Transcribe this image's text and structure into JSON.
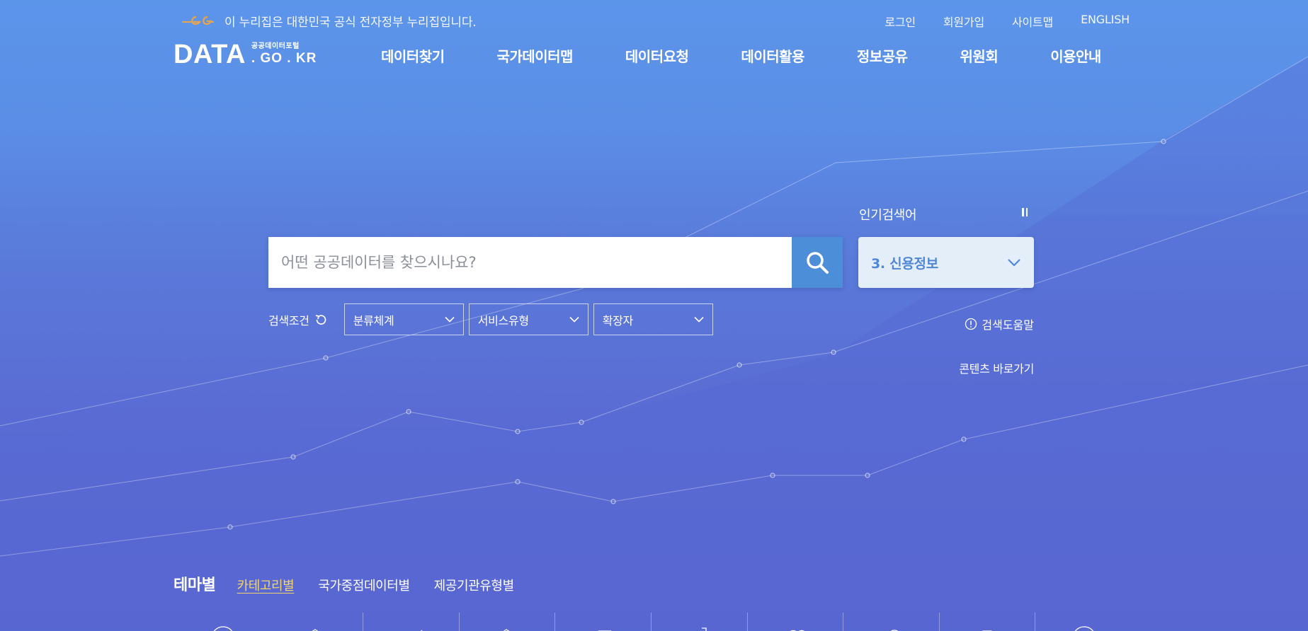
{
  "gov_notice": {
    "text": "이 누리집은 대한민국 공식 전자정부 누리집입니다.",
    "icon": "eg-gov-emblem-icon"
  },
  "util_nav": [
    {
      "label": "로그인"
    },
    {
      "label": "회원가입"
    },
    {
      "label": "사이트맵"
    },
    {
      "label": "ENGLISH"
    }
  ],
  "logo": {
    "main": "DATA",
    "sub_small": "공공데이터포털",
    "sub_domain": ". GO . KR"
  },
  "main_nav": [
    {
      "label": "데이터찾기"
    },
    {
      "label": "국가데이터맵"
    },
    {
      "label": "데이터요청"
    },
    {
      "label": "데이터활용"
    },
    {
      "label": "정보공유"
    },
    {
      "label": "위원회"
    },
    {
      "label": "이용안내"
    }
  ],
  "search": {
    "placeholder": "어떤 공공데이터를 찾으시나요?",
    "button_icon": "search-icon"
  },
  "popular": {
    "title": "인기검색어",
    "current": "3. 신용정보",
    "pause_icon": "pause-icon"
  },
  "filters": {
    "label": "검색조건",
    "reset_icon": "refresh-icon",
    "selects": [
      {
        "label": "분류체계"
      },
      {
        "label": "서비스유형"
      },
      {
        "label": "확장자"
      }
    ]
  },
  "links": {
    "help": "검색도움말",
    "contents": "콘텐츠 바로가기"
  },
  "tabs": {
    "title": "테마별",
    "items": [
      {
        "label": "카테고리별",
        "active": true
      },
      {
        "label": "국가중점데이터별",
        "active": false
      },
      {
        "label": "제공기관유형별",
        "active": false
      }
    ]
  },
  "colors": {
    "accent": "#4c8fd8",
    "active_tab": "#f2d66b",
    "popular_text": "#4f86d6"
  }
}
